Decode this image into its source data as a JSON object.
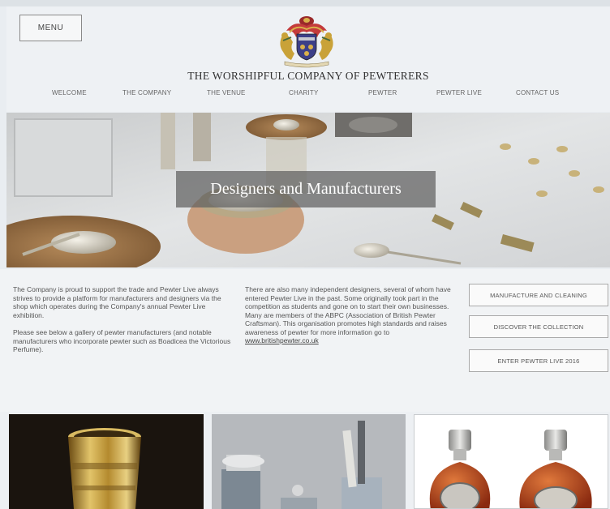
{
  "header": {
    "menu_label": "MENU",
    "site_title": "THE WORSHIPFUL COMPANY OF PEWTERERS",
    "crest_icon": "coat-of-arms-icon"
  },
  "nav": {
    "items": [
      {
        "label": "WELCOME"
      },
      {
        "label": "THE COMPANY"
      },
      {
        "label": "THE VENUE"
      },
      {
        "label": "CHARITY"
      },
      {
        "label": "PEWTER"
      },
      {
        "label": "PEWTER LIVE"
      },
      {
        "label": "CONTACT US"
      }
    ]
  },
  "hero": {
    "caption": "Designers and Manufacturers"
  },
  "content": {
    "left_p1": "The Company is proud to support the trade and Pewter Live always strives to provide a platform for manufacturers and designers via the shop which operates during the Company's annual Pewter Live exhibition.",
    "left_p2": "Please see below a gallery of pewter manufacturers (and notable manufacturers who incorporate pewter such as Boadicea the Victorious Perfume).",
    "middle_p1": "There are also many independent designers, several of whom have entered Pewter Live in the past. Some originally took part in the competition as students and gone on to start their own businesses. Many are members of the ABPC (Association of British Pewter Craftsman). This organisation promotes high standards and raises awareness of pewter for more information go to",
    "middle_link": "www.britishpewter.co.uk"
  },
  "sidebar": {
    "buttons": [
      {
        "label": "MANUFACTURE AND CLEANING"
      },
      {
        "label": "DISCOVER THE COLLECTION"
      },
      {
        "label": "ENTER PEWTER LIVE 2016"
      }
    ]
  },
  "colors": {
    "page_bg": "#e9edf1",
    "caption_bg": "#5f5f5f",
    "text": "#555555"
  }
}
